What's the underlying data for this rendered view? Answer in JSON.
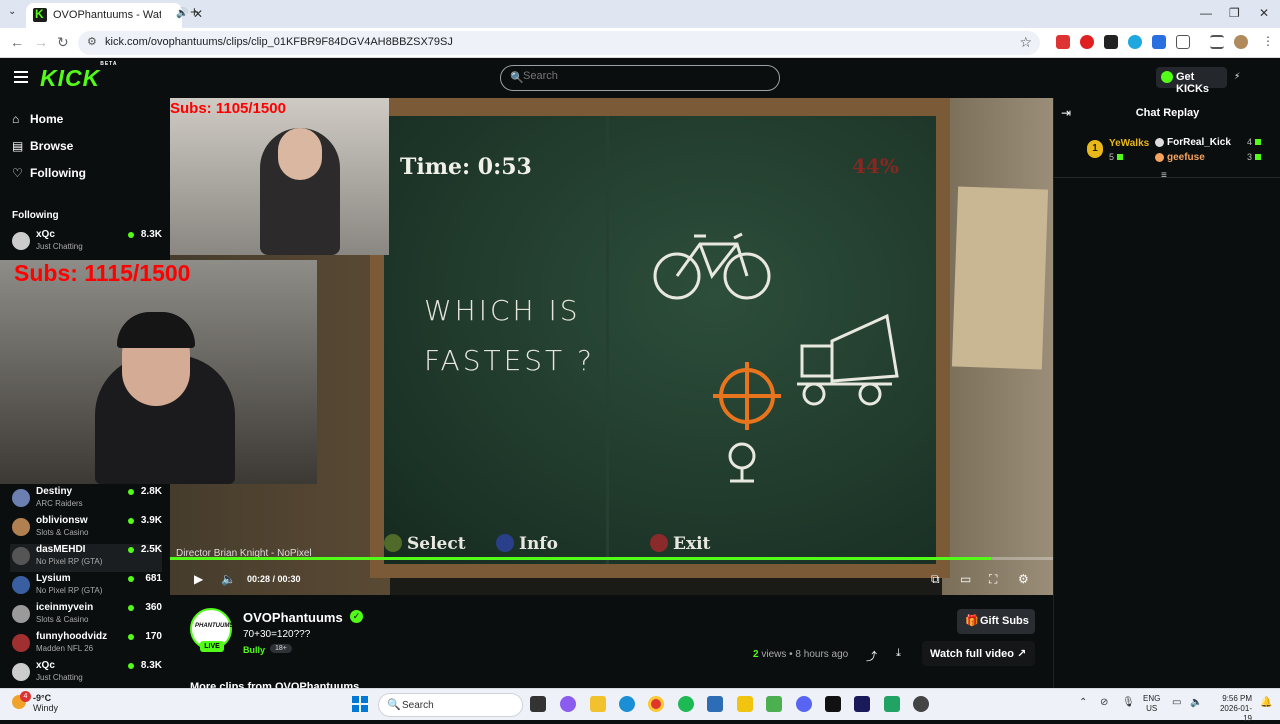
{
  "browser": {
    "tab_title": "OVOPhantuums - Watch cli",
    "url": "kick.com/ovophantuums/clips/clip_01KFBR9F84DGV4AH8BBZSX79SJ"
  },
  "header": {
    "logo": "KICK",
    "logo_badge": "BETA",
    "search_placeholder": "Search",
    "get_kicks_label": "Get KICKs"
  },
  "sidebar": {
    "nav": [
      {
        "label": "Home",
        "icon": "home-icon"
      },
      {
        "label": "Browse",
        "icon": "browse-icon"
      },
      {
        "label": "Following",
        "icon": "heart-icon"
      }
    ],
    "following_header": "Following",
    "channels": [
      {
        "name": "xQc",
        "category": "Just Chatting",
        "viewers": "8.3K",
        "color": "#cccccc"
      },
      {
        "name": "Destiny",
        "category": "ARC Raiders",
        "viewers": "2.8K",
        "color": "#6b7fb0"
      },
      {
        "name": "oblivionsw",
        "category": "Slots & Casino",
        "viewers": "3.9K",
        "color": "#b08050"
      },
      {
        "name": "dasMEHDI",
        "category": "No Pixel RP (GTA)",
        "viewers": "2.5K",
        "color": "#555555"
      },
      {
        "name": "Lysium",
        "category": "No Pixel RP (GTA)",
        "viewers": "681",
        "color": "#3a5fa0"
      },
      {
        "name": "iceinmyvein",
        "category": "Slots & Casino",
        "viewers": "360",
        "color": "#9a9a9a"
      },
      {
        "name": "funnyhoodvidz",
        "category": "Madden NFL 26",
        "viewers": "170",
        "color": "#a03030"
      },
      {
        "name": "xQc",
        "category": "Just Chatting",
        "viewers": "8.3K",
        "color": "#cccccc"
      }
    ]
  },
  "video": {
    "overlay_subs_top": "Subs: 1105/1500",
    "overlay_subs_main": "Subs: 1115/1500",
    "game_time": "Time:  0:53",
    "game_percent": "44%",
    "game_question_line1": "WHICH IS",
    "game_question_line2": "FASTEST ?",
    "hint_select": "Select",
    "hint_info": "Info",
    "hint_exit": "Exit",
    "director_label": "Director Brian Knight - NoPixel",
    "time_current": "00:28",
    "time_total": "00:30",
    "progress": 0.93
  },
  "chat": {
    "title": "Chat Replay",
    "leaderboard": [
      {
        "rank": "1",
        "name": "YeWalks",
        "count": "5"
      },
      {
        "name": "ForReal_Kick",
        "count": "4"
      },
      {
        "name": "geefuse",
        "count": "3"
      }
    ]
  },
  "channel": {
    "name": "OVOPhantuums",
    "avatar_text": "PHANTUUMS",
    "live_label": "LIVE",
    "clip_title": "70+30=120???",
    "category": "Bully",
    "age_badge": "18+",
    "gift_subs_label": "Gift Subs",
    "views_count": "2",
    "views_word": " views",
    "posted": " • 8 hours ago",
    "watch_full_label": "Watch full video",
    "more_clips": "More clips from OVOPhantuums"
  },
  "taskbar": {
    "temp": "-9°C",
    "weather": "Windy",
    "search_label": "Search",
    "lang_1": "ENG",
    "lang_2": "US",
    "time": "9:56 PM",
    "date": "2026-01-19",
    "notification_count": "4"
  }
}
